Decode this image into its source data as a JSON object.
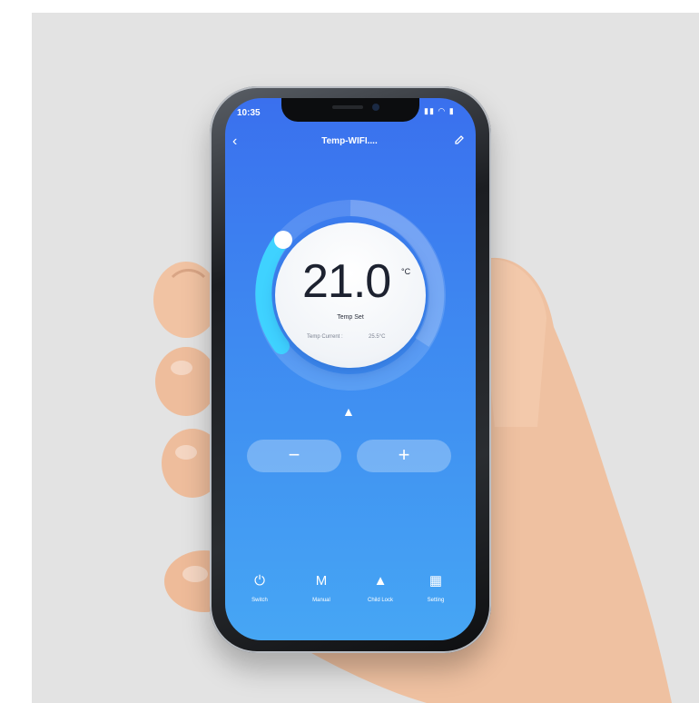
{
  "status_bar": {
    "time": "10:35",
    "icons": "▮▮ ◠ ▮"
  },
  "header": {
    "title": "Temp-WIFI...."
  },
  "dial": {
    "temperature": "21.0",
    "unit": "°C",
    "label": "Temp Set",
    "current_label": "Temp Current :",
    "current_value": "25.5°C"
  },
  "controls": {
    "minus": "−",
    "plus": "+"
  },
  "bottom_tabs": [
    {
      "icon": "⏻",
      "label": "Switch"
    },
    {
      "icon": "M",
      "label": "Manual"
    },
    {
      "icon": "▲",
      "label": "Child Lock"
    },
    {
      "icon": "▦",
      "label": "Setting"
    }
  ],
  "colors": {
    "accent": "#3a70ee",
    "arc": "#3fd2ff"
  }
}
